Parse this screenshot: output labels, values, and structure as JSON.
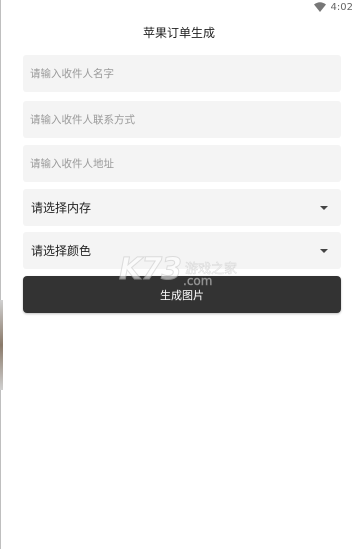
{
  "statusbar": {
    "time": "4:02",
    "wifi_icon": "wifi-icon"
  },
  "header": {
    "title": "苹果订单生成"
  },
  "form": {
    "name_placeholder": "请输入收件人名字",
    "contact_placeholder": "请输入收件人联系方式",
    "address_placeholder": "请输入收件人地址",
    "memory_select": "请选择内存",
    "color_select": "请选择颜色",
    "generate_button": "生成图片"
  },
  "watermark": {
    "logo": "K73",
    "name": "游戏之家",
    "domain": ".com"
  },
  "colors": {
    "button_bg": "#333333",
    "field_bg": "#f4f4f4",
    "placeholder": "#9a9a9a"
  }
}
